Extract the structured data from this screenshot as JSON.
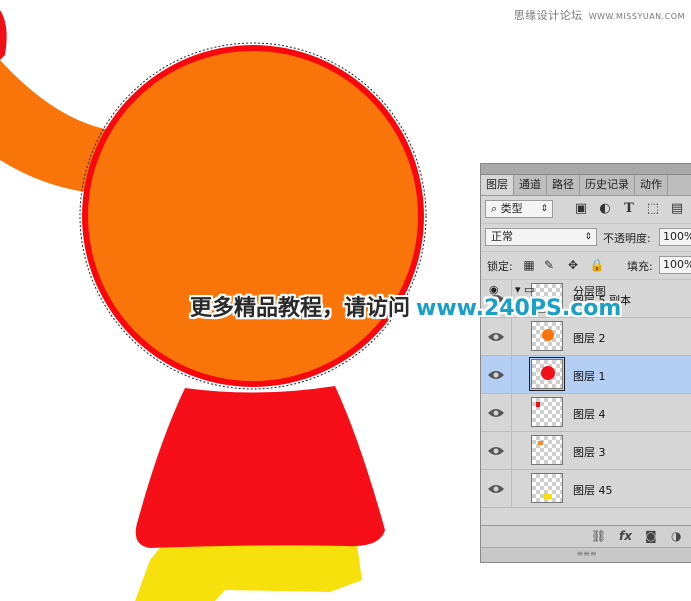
{
  "watermark": {
    "text": "思缘设计论坛",
    "site": "WWW.MISSYUAN.COM"
  },
  "overlay": {
    "chinese": "更多精品教程，请访问",
    "url": "www.240PS.com"
  },
  "canvas_colors": {
    "orange": "#f97509",
    "red": "#f0101a",
    "yellow": "#f6e10d"
  },
  "layers_panel": {
    "tabs": [
      "图层",
      "通道",
      "路径",
      "历史记录",
      "动作"
    ],
    "filter": {
      "icon": "search-icon",
      "label": "类型"
    },
    "blend_mode": "正常",
    "opacity_label": "不透明度:",
    "opacity_value": "100%",
    "lock_label": "锁定:",
    "fill_label": "填充:",
    "fill_value": "100%",
    "group_name": "分层图",
    "layers": [
      {
        "name": "图层 5 副本",
        "selected": false,
        "thumb_color": "#e8101a"
      },
      {
        "name": "图层 2",
        "selected": false,
        "thumb_color": "#f97509"
      },
      {
        "name": "图层 1",
        "selected": true,
        "thumb_color": "#f0101a"
      },
      {
        "name": "图层 4",
        "selected": false,
        "thumb_color": "#e8101a"
      },
      {
        "name": "图层 3",
        "selected": false,
        "thumb_color": "#f08a2a"
      },
      {
        "name": "图层 45",
        "selected": false,
        "thumb_color": "#f6e10d"
      }
    ],
    "bottom_icons": [
      "link-icon",
      "fx-icon",
      "mask-icon",
      "adjustment-icon"
    ]
  }
}
